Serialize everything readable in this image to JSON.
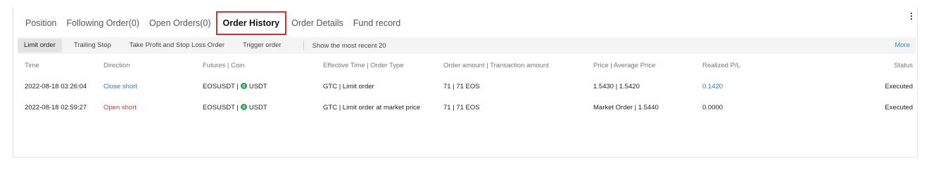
{
  "tabs": [
    {
      "label": "Position"
    },
    {
      "label": "Following Order(0)"
    },
    {
      "label": "Open Orders(0)"
    },
    {
      "label": "Order History"
    },
    {
      "label": "Order Details"
    },
    {
      "label": "Fund record"
    }
  ],
  "subtabs": [
    {
      "label": "Limit order"
    },
    {
      "label": "Trailing Stop"
    },
    {
      "label": "Take Profit and Stop Loss Order"
    },
    {
      "label": "Trigger order"
    }
  ],
  "filter": {
    "recent_label": "Show the most recent 20",
    "more_label": "More"
  },
  "table": {
    "headers": [
      "Time",
      "Direction",
      "Futures | Coin",
      "Effective Time | Order Type",
      "Order amount | Transaction amount",
      "Price | Average Price",
      "Realized P/L",
      "Status"
    ],
    "rows": [
      {
        "time": "2022-08-18 03:26:04",
        "direction": "Close short",
        "futures": "EOSUSDT |",
        "coin": "USDT",
        "effective": "GTC | Limit order",
        "amount": "71 | 71 EOS",
        "price": "1.5430 | 1.5420",
        "pl": "0.1420",
        "status": "Executed"
      },
      {
        "time": "2022-08-18 02:59:27",
        "direction": "Open short",
        "futures": "EOSUSDT |",
        "coin": "USDT",
        "effective": "GTC | Limit order at market price",
        "amount": "71 | 71 EOS",
        "price": "Market Order | 1.5440",
        "pl": "0.0000",
        "status": "Executed"
      }
    ]
  },
  "colors": {
    "active_tab_border": "#d0312d",
    "close_short": "#2f77c4",
    "open_short": "#e2312d",
    "link": "#3a8bd6",
    "coin_icon": "#2e9c56"
  },
  "icons": {
    "coin": "usdt-coin-icon",
    "menu": "more-vertical-icon"
  }
}
